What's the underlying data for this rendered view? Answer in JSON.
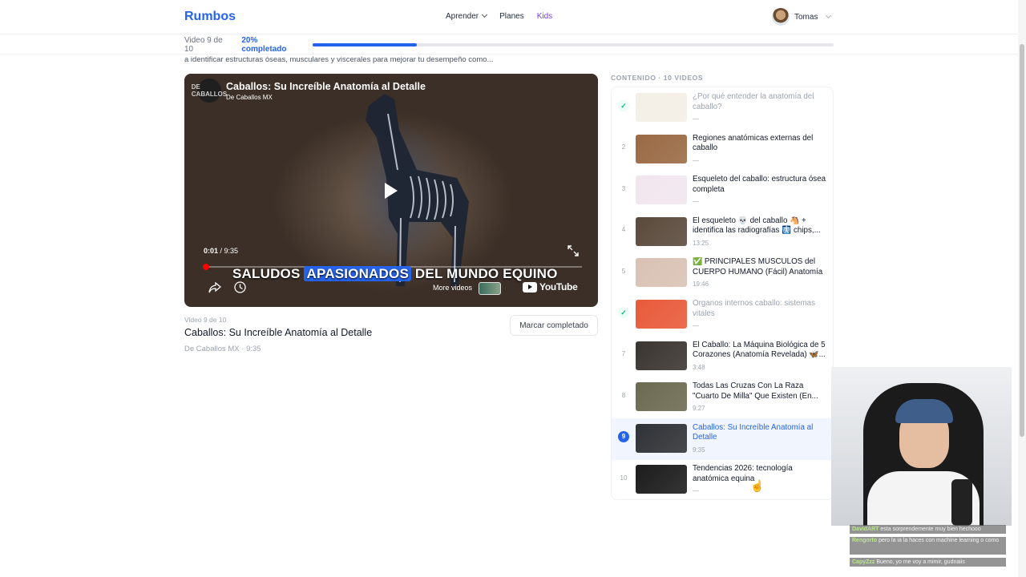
{
  "nav": {
    "logo": "Rumbos",
    "links": [
      "Aprender",
      "Planes",
      "Kids"
    ],
    "user_name": "Tomas"
  },
  "progress": {
    "count_label": "Video 9 de 10",
    "percent_label": "20% completado",
    "fraction": 0.2
  },
  "description": "a identificar estructuras óseas, musculares y viscerales para mejorar tu desempeño como...",
  "player": {
    "title": "Caballos: Su Increíble Anatomía al Detalle",
    "channel": "De Caballos MX",
    "channel_badge": "DE CABALLOS",
    "time_current": "0:01",
    "time_total": "9:35",
    "caption_words": [
      "SALUDOS",
      "APASIONADOS",
      "DEL MUNDO EQUINO"
    ],
    "more_videos": "More videos",
    "youtube": "YouTube"
  },
  "current": {
    "count": "Video 9 de 10",
    "title": "Caballos: Su Increíble Anatomía al Detalle",
    "meta": "De Caballos MX · 9:35",
    "mark_button": "Marcar completado"
  },
  "sidebar": {
    "heading": "CONTENIDO · 10 VIDEOS",
    "items": [
      {
        "num": "✓",
        "state": "done",
        "title": "¿Por qué entender la anatomía del caballo?",
        "duration": "—",
        "thumb": "#f3efe6"
      },
      {
        "num": "2",
        "state": "todo",
        "title": "Regiones anatómicas externas del caballo",
        "duration": "—",
        "thumb": "#9a6a44"
      },
      {
        "num": "3",
        "state": "todo",
        "title": "Esqueleto del caballo: estructura ósea completa",
        "duration": "—",
        "thumb": "#f1e6ee"
      },
      {
        "num": "4",
        "state": "todo",
        "title": "El esqueleto 💀 del caballo 🐴 + identifica las radiografías 🩻 chips,...",
        "duration": "13:25",
        "thumb": "#5a4a3c"
      },
      {
        "num": "5",
        "state": "todo",
        "title": "✅ PRINCIPALES MÚSCULOS del CUERPO HUMANO (Fácil) Anatomía",
        "duration": "19:46",
        "thumb": "#d9c2b4"
      },
      {
        "num": "✓",
        "state": "done",
        "title": "Órganos internos caballo: sistemas vitales",
        "duration": "—",
        "thumb": "#e85a3a"
      },
      {
        "num": "7",
        "state": "todo",
        "title": "El Caballo: La Máquina Biológica de 5 Corazones (Anatomía Revelada) 🦋...",
        "duration": "3:48",
        "thumb": "#3a3530"
      },
      {
        "num": "8",
        "state": "todo",
        "title": "Todas Las Cruzas Con La Raza \"Cuarto De Milla\" Que Existen (En...",
        "duration": "9:27",
        "thumb": "#6d6a52"
      },
      {
        "num": "9",
        "state": "active",
        "title": "Caballos: Su Increíble Anatomía al Detalle",
        "duration": "9:35",
        "thumb": "#2f3236"
      },
      {
        "num": "10",
        "state": "todo",
        "title": "Tendencias 2026: tecnología anatómica equina",
        "duration": "—",
        "thumb": "#1c1c1c"
      }
    ]
  },
  "chat": [
    {
      "user": "DavidART",
      "text": "esta sorprendemente muy bien hechooo"
    },
    {
      "user": "Rengorto",
      "text": "pero la ia la haces con machine learning o como"
    },
    {
      "user": "CapyZzz",
      "text": "Bueno, yo me voy a mimir, gudnaiis"
    }
  ]
}
